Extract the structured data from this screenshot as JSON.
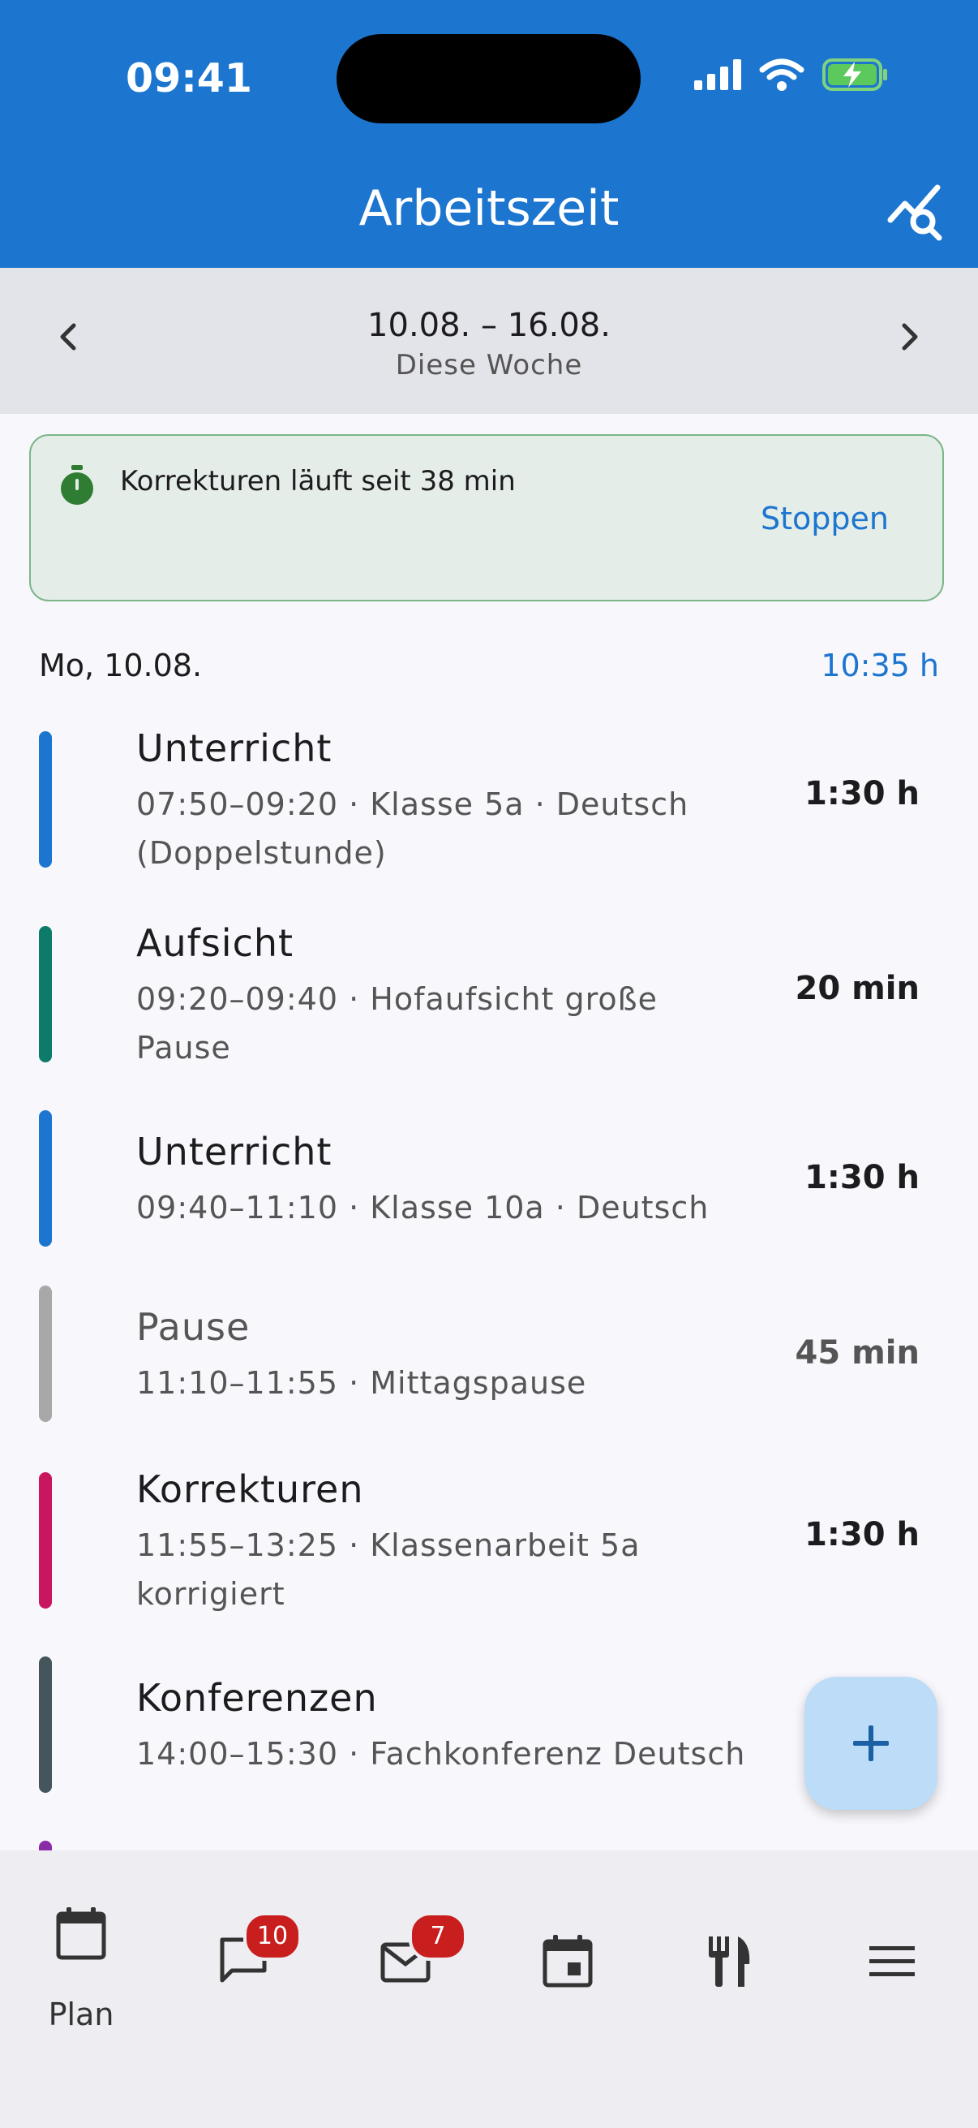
{
  "status": {
    "time": "09:41"
  },
  "header": {
    "title": "Arbeitszeit"
  },
  "week": {
    "range": "10.08. – 16.08.",
    "subtitle": "Diese Woche"
  },
  "running": {
    "text": "Korrekturen läuft seit 38 min",
    "action": "Stoppen"
  },
  "day": {
    "label": "Mo, 10.08.",
    "total": "10:35 h"
  },
  "entries": [
    {
      "title": "Unterricht",
      "line1": "07:50–09:20 · Klasse 5a · Deutsch",
      "line2": "(Doppelstunde)",
      "duration": "1:30 h",
      "color": "#1c75cf"
    },
    {
      "title": "Aufsicht",
      "line1": "09:20–09:40 · Hofaufsicht große",
      "line2": "Pause",
      "duration": "20 min",
      "color": "#0e7a6a"
    },
    {
      "title": "Unterricht",
      "line1": "09:40–11:10 · Klasse 10a · Deutsch",
      "line2": "",
      "duration": "1:30 h",
      "color": "#1c75cf"
    },
    {
      "title": "Pause",
      "line1": "11:10–11:55 · Mittagspause",
      "line2": "",
      "duration": "45 min",
      "color": "#a8a8a8"
    },
    {
      "title": "Korrekturen",
      "line1": "11:55–13:25 · Klassenarbeit 5a",
      "line2": "korrigiert",
      "duration": "1:30 h",
      "color": "#c8175e"
    },
    {
      "title": "Konferenzen",
      "line1": "14:00–15:30 · Fachkonferenz Deutsch",
      "line2": "",
      "duration": "",
      "color": "#45555c"
    }
  ],
  "nav": {
    "plan_label": "Plan",
    "messages_badge": "10",
    "mail_badge": "7"
  },
  "colors": {
    "primary": "#1c75cf",
    "running_bg": "#e5ede8",
    "running_border": "#7cb687",
    "fab": "#bcdcf7",
    "badge": "#c81e1e"
  }
}
